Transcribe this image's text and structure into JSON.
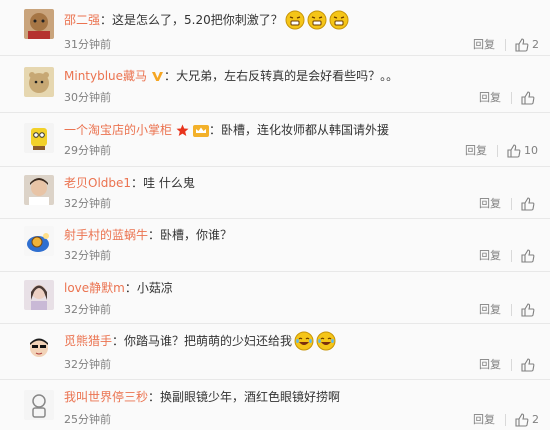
{
  "comments": [
    {
      "user": "邵二强",
      "sep": "：",
      "text": "这是怎么了，5.20把你刺激了？",
      "time": "31分钟前",
      "likes": "2",
      "emojis": 3,
      "emoji_type": "angry"
    },
    {
      "user": "Mintyblue藏马",
      "sep": "：",
      "text": "大兄弟，左右反转真的是会好看些吗？。。",
      "time": "30分钟前",
      "likes": "",
      "verified": true
    },
    {
      "user": "一个淘宝店的小掌柜",
      "sep": "：",
      "text": "卧槽，连化妆师都从韩国请外援",
      "time": "29分钟前",
      "likes": "10",
      "badges": true
    },
    {
      "user": "老贝Oldbe1",
      "sep": "：",
      "text": "哇 什么鬼",
      "time": "32分钟前",
      "likes": ""
    },
    {
      "user": "射手村的蓝蜗牛",
      "sep": "：",
      "text": "卧槽，你谁？",
      "time": "32分钟前",
      "likes": ""
    },
    {
      "user": "love静默m",
      "sep": "：",
      "text": "小菇凉",
      "time": "32分钟前",
      "likes": ""
    },
    {
      "user": "觅熊猎手",
      "sep": "：",
      "text": "你踏马谁？把萌萌的少妇还给我",
      "time": "32分钟前",
      "likes": "",
      "emojis": 2,
      "emoji_type": "laugh"
    },
    {
      "user": "我叫世界停三秒",
      "sep": "：",
      "text": "换副眼镜少年，酒红色眼镜好捞啊",
      "time": "25分钟前",
      "likes": "2"
    }
  ],
  "reply_label": "回复",
  "colors": {
    "username": "#eb7350",
    "muted": "#808080",
    "emoji": "#f5c518"
  },
  "icons": {
    "like": "thumbs-up-icon",
    "verified": "verified-v-icon",
    "star": "star-icon",
    "crown": "crown-badge-icon"
  }
}
